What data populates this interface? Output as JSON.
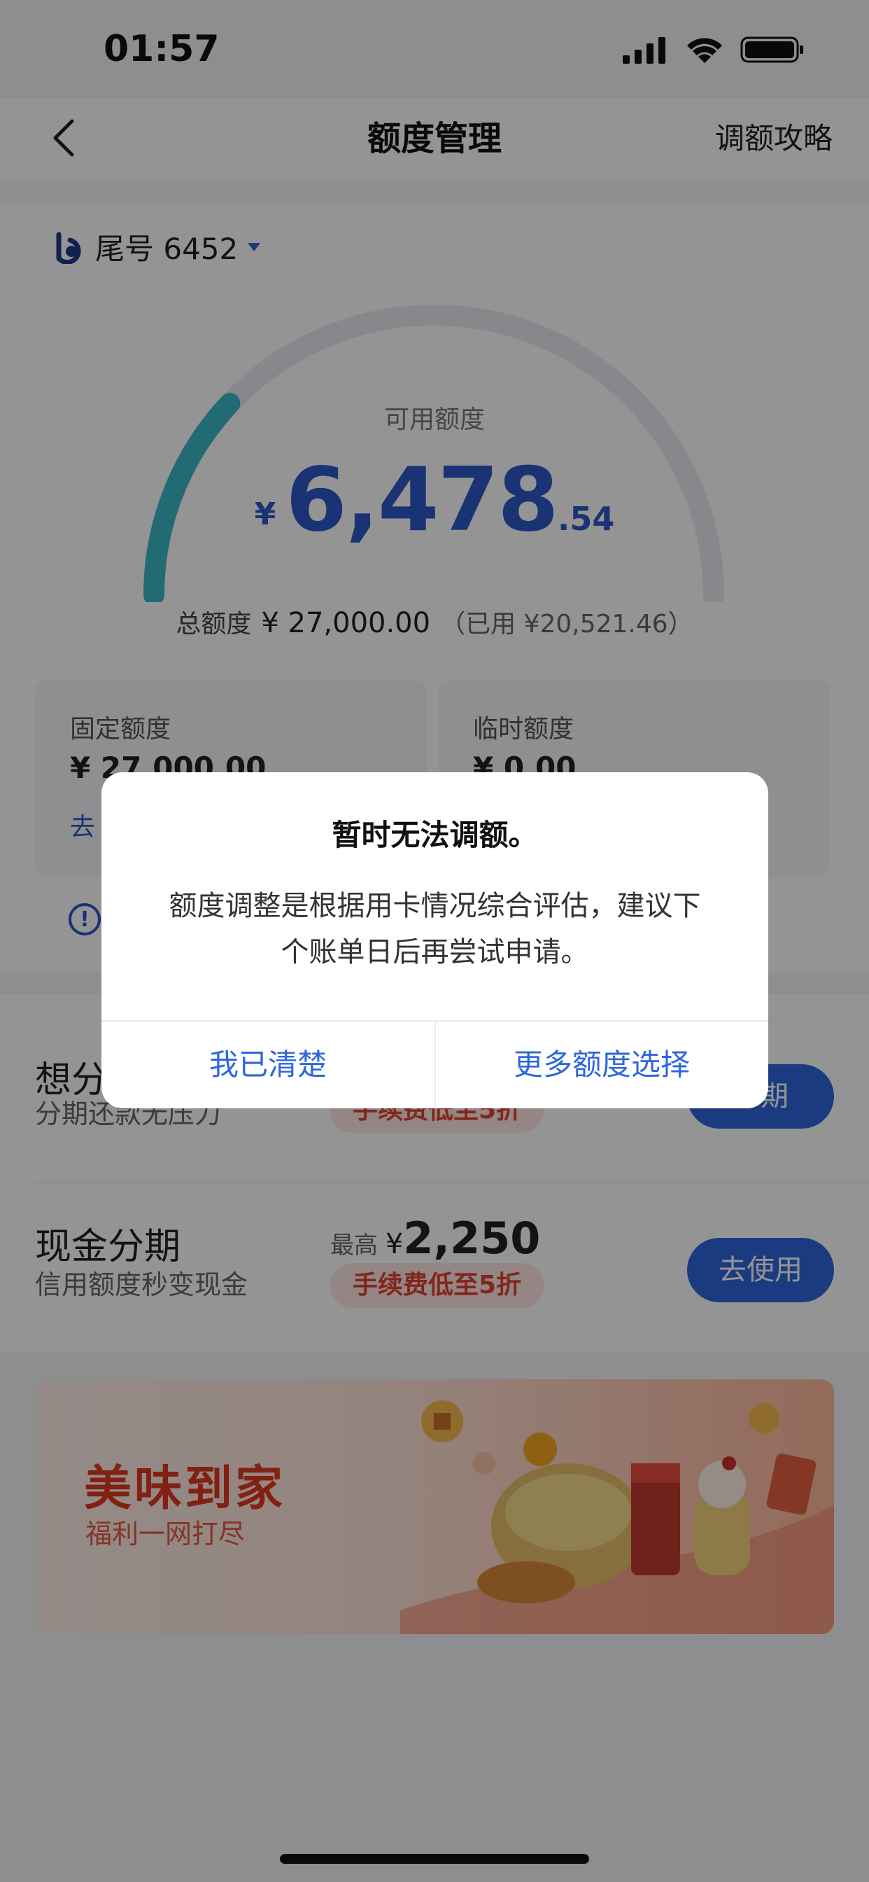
{
  "status_bar": {
    "time": "01:57",
    "icons": [
      "signal-icon",
      "wifi-icon",
      "battery-icon"
    ]
  },
  "nav": {
    "title": "额度管理",
    "right_action": "调额攻略"
  },
  "card": {
    "card_label": "尾号 6452"
  },
  "limit": {
    "available_label": "可用额度",
    "currency": "¥",
    "available_int": "6,478",
    "available_dec": ".54",
    "available_fraction": 0.24,
    "total_label": "总额度",
    "total_value": "¥ 27,000.00",
    "used_text": "（已用 ¥20,521.46）"
  },
  "sub_limits": {
    "fixed": {
      "label": "固定额度",
      "value": "¥ 27,000.00",
      "link": "去"
    },
    "temp": {
      "label": "临时额度",
      "value": "¥ 0.00"
    }
  },
  "installments": [
    {
      "title": "想分",
      "subtitle": "分期还款无压力",
      "fee_tag": "手续费低至5折",
      "button": "分期"
    },
    {
      "title": "现金分期",
      "subtitle": "信用额度秒变现金",
      "max_prefix": "最高",
      "max_currency": "¥",
      "max_value": "2,250",
      "fee_tag": "手续费低至5折",
      "button": "去使用"
    }
  ],
  "banner": {
    "title": "美味到家",
    "subtitle": "福利一网打尽"
  },
  "dialog": {
    "title": "暂时无法调额。",
    "message": "额度调整是根据用卡情况综合评估，建议下个账单日后再尝试申请。",
    "cancel": "我已清楚",
    "confirm": "更多额度选择"
  },
  "colors": {
    "accent": "#2e66dd",
    "gauge_fill": "#3cb8c8",
    "fee_red": "#e0432f"
  }
}
